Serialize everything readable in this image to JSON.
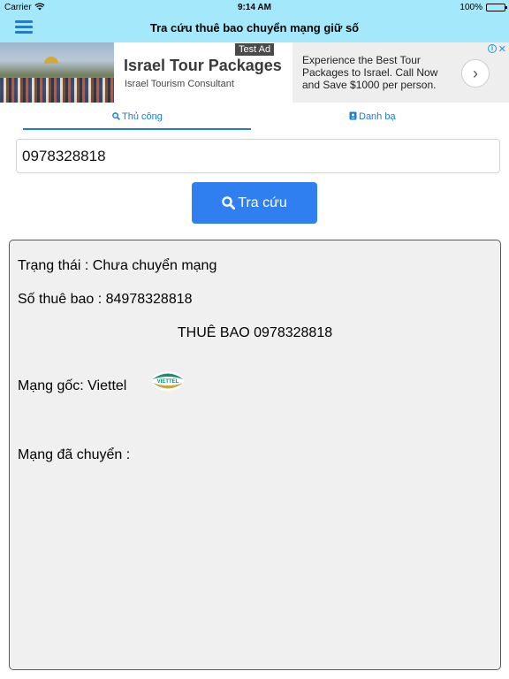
{
  "status_bar": {
    "carrier": "Carrier",
    "time": "9:14 AM",
    "battery": "100%",
    "battery_level": 1.0
  },
  "nav": {
    "title": "Tra cứu thuê bao chuyển mạng giữ số"
  },
  "ad": {
    "badge": "Test Ad",
    "headline": "Israel Tour Packages",
    "advertiser": "Israel Tourism Consultant",
    "description": "Experience the Best Tour Packages to Israel. Call Now and Save $1000 per person.",
    "arrow": "›",
    "info": "i",
    "close": "✕"
  },
  "tabs": [
    {
      "label": "Thủ công",
      "active": true
    },
    {
      "label": "Danh bạ",
      "active": false
    }
  ],
  "search": {
    "value": "0978328818"
  },
  "button": {
    "label": "Tra cứu"
  },
  "result": {
    "status": "Trạng thái : Chưa chuyển mạng",
    "subscriber": "Số thuê bao : 84978328818",
    "header": "THUÊ BAO 0978328818",
    "origin": "Mạng gốc: Viettel",
    "moved": "Mạng đã chuyển :",
    "origin_logo_text": "VIETTEL"
  },
  "colors": {
    "header_bg": "#a3e8fb",
    "accent": "#2f7ff0",
    "tab_blue": "#1a7ce0",
    "panel_bg": "#f0f0f0"
  }
}
